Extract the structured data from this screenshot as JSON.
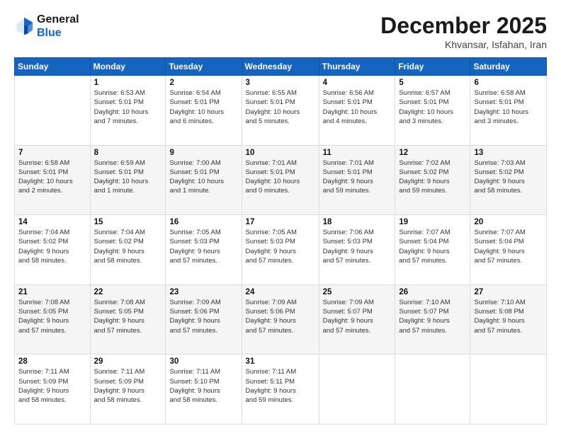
{
  "header": {
    "logo": {
      "general": "General",
      "blue": "Blue"
    },
    "title": "December 2025",
    "subtitle": "Khvansar, Isfahan, Iran"
  },
  "calendar": {
    "days_of_week": [
      "Sunday",
      "Monday",
      "Tuesday",
      "Wednesday",
      "Thursday",
      "Friday",
      "Saturday"
    ],
    "weeks": [
      [
        {
          "day": "",
          "info": ""
        },
        {
          "day": "1",
          "info": "Sunrise: 6:53 AM\nSunset: 5:01 PM\nDaylight: 10 hours\nand 7 minutes."
        },
        {
          "day": "2",
          "info": "Sunrise: 6:54 AM\nSunset: 5:01 PM\nDaylight: 10 hours\nand 6 minutes."
        },
        {
          "day": "3",
          "info": "Sunrise: 6:55 AM\nSunset: 5:01 PM\nDaylight: 10 hours\nand 5 minutes."
        },
        {
          "day": "4",
          "info": "Sunrise: 6:56 AM\nSunset: 5:01 PM\nDaylight: 10 hours\nand 4 minutes."
        },
        {
          "day": "5",
          "info": "Sunrise: 6:57 AM\nSunset: 5:01 PM\nDaylight: 10 hours\nand 3 minutes."
        },
        {
          "day": "6",
          "info": "Sunrise: 6:58 AM\nSunset: 5:01 PM\nDaylight: 10 hours\nand 3 minutes."
        }
      ],
      [
        {
          "day": "7",
          "info": "Sunrise: 6:58 AM\nSunset: 5:01 PM\nDaylight: 10 hours\nand 2 minutes."
        },
        {
          "day": "8",
          "info": "Sunrise: 6:59 AM\nSunset: 5:01 PM\nDaylight: 10 hours\nand 1 minute."
        },
        {
          "day": "9",
          "info": "Sunrise: 7:00 AM\nSunset: 5:01 PM\nDaylight: 10 hours\nand 1 minute."
        },
        {
          "day": "10",
          "info": "Sunrise: 7:01 AM\nSunset: 5:01 PM\nDaylight: 10 hours\nand 0 minutes."
        },
        {
          "day": "11",
          "info": "Sunrise: 7:01 AM\nSunset: 5:01 PM\nDaylight: 9 hours\nand 59 minutes."
        },
        {
          "day": "12",
          "info": "Sunrise: 7:02 AM\nSunset: 5:02 PM\nDaylight: 9 hours\nand 59 minutes."
        },
        {
          "day": "13",
          "info": "Sunrise: 7:03 AM\nSunset: 5:02 PM\nDaylight: 9 hours\nand 58 minutes."
        }
      ],
      [
        {
          "day": "14",
          "info": "Sunrise: 7:04 AM\nSunset: 5:02 PM\nDaylight: 9 hours\nand 58 minutes."
        },
        {
          "day": "15",
          "info": "Sunrise: 7:04 AM\nSunset: 5:02 PM\nDaylight: 9 hours\nand 58 minutes."
        },
        {
          "day": "16",
          "info": "Sunrise: 7:05 AM\nSunset: 5:03 PM\nDaylight: 9 hours\nand 57 minutes."
        },
        {
          "day": "17",
          "info": "Sunrise: 7:05 AM\nSunset: 5:03 PM\nDaylight: 9 hours\nand 57 minutes."
        },
        {
          "day": "18",
          "info": "Sunrise: 7:06 AM\nSunset: 5:03 PM\nDaylight: 9 hours\nand 57 minutes."
        },
        {
          "day": "19",
          "info": "Sunrise: 7:07 AM\nSunset: 5:04 PM\nDaylight: 9 hours\nand 57 minutes."
        },
        {
          "day": "20",
          "info": "Sunrise: 7:07 AM\nSunset: 5:04 PM\nDaylight: 9 hours\nand 57 minutes."
        }
      ],
      [
        {
          "day": "21",
          "info": "Sunrise: 7:08 AM\nSunset: 5:05 PM\nDaylight: 9 hours\nand 57 minutes."
        },
        {
          "day": "22",
          "info": "Sunrise: 7:08 AM\nSunset: 5:05 PM\nDaylight: 9 hours\nand 57 minutes."
        },
        {
          "day": "23",
          "info": "Sunrise: 7:09 AM\nSunset: 5:06 PM\nDaylight: 9 hours\nand 57 minutes."
        },
        {
          "day": "24",
          "info": "Sunrise: 7:09 AM\nSunset: 5:06 PM\nDaylight: 9 hours\nand 57 minutes."
        },
        {
          "day": "25",
          "info": "Sunrise: 7:09 AM\nSunset: 5:07 PM\nDaylight: 9 hours\nand 57 minutes."
        },
        {
          "day": "26",
          "info": "Sunrise: 7:10 AM\nSunset: 5:07 PM\nDaylight: 9 hours\nand 57 minutes."
        },
        {
          "day": "27",
          "info": "Sunrise: 7:10 AM\nSunset: 5:08 PM\nDaylight: 9 hours\nand 57 minutes."
        }
      ],
      [
        {
          "day": "28",
          "info": "Sunrise: 7:11 AM\nSunset: 5:09 PM\nDaylight: 9 hours\nand 58 minutes."
        },
        {
          "day": "29",
          "info": "Sunrise: 7:11 AM\nSunset: 5:09 PM\nDaylight: 9 hours\nand 58 minutes."
        },
        {
          "day": "30",
          "info": "Sunrise: 7:11 AM\nSunset: 5:10 PM\nDaylight: 9 hours\nand 58 minutes."
        },
        {
          "day": "31",
          "info": "Sunrise: 7:11 AM\nSunset: 5:11 PM\nDaylight: 9 hours\nand 59 minutes."
        },
        {
          "day": "",
          "info": ""
        },
        {
          "day": "",
          "info": ""
        },
        {
          "day": "",
          "info": ""
        }
      ]
    ]
  }
}
